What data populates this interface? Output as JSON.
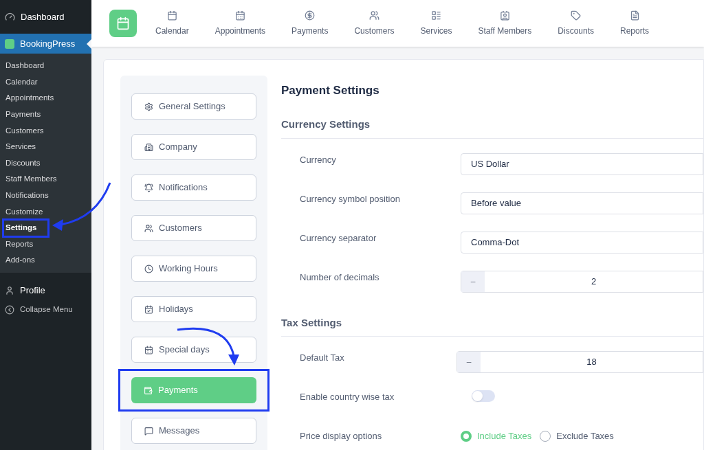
{
  "admin_menu": {
    "top_items": [
      {
        "label": "Dashboard",
        "kind": "dashboard"
      }
    ],
    "plugin": {
      "label": "BookingPress",
      "selected": true
    },
    "submenu": [
      {
        "label": "Dashboard",
        "selected": false
      },
      {
        "label": "Calendar",
        "selected": false
      },
      {
        "label": "Appointments",
        "selected": false
      },
      {
        "label": "Payments",
        "selected": false
      },
      {
        "label": "Customers",
        "selected": false
      },
      {
        "label": "Services",
        "selected": false
      },
      {
        "label": "Discounts",
        "selected": false
      },
      {
        "label": "Staff Members",
        "selected": false
      },
      {
        "label": "Notifications",
        "selected": false
      },
      {
        "label": "Customize",
        "selected": false
      },
      {
        "label": "Settings",
        "selected": true
      },
      {
        "label": "Reports",
        "selected": false
      },
      {
        "label": "Add-ons",
        "selected": false
      }
    ],
    "bottom_items": [
      {
        "label": "Profile",
        "kind": "profile"
      },
      {
        "label": "Collapse Menu",
        "kind": "collapse"
      }
    ]
  },
  "top_nav": [
    {
      "label": "Calendar",
      "kind": "calendar"
    },
    {
      "label": "Appointments",
      "kind": "appointments"
    },
    {
      "label": "Payments",
      "kind": "payments"
    },
    {
      "label": "Customers",
      "kind": "customers"
    },
    {
      "label": "Services",
      "kind": "services"
    },
    {
      "label": "Staff Members",
      "kind": "staff"
    },
    {
      "label": "Discounts",
      "kind": "discounts"
    },
    {
      "label": "Reports",
      "kind": "reports"
    }
  ],
  "settings_menu": [
    {
      "label": "General Settings",
      "kind": "general",
      "selected": false
    },
    {
      "label": "Company",
      "kind": "company",
      "selected": false
    },
    {
      "label": "Notifications",
      "kind": "notifications",
      "selected": false
    },
    {
      "label": "Customers",
      "kind": "customers",
      "selected": false
    },
    {
      "label": "Working Hours",
      "kind": "hours",
      "selected": false
    },
    {
      "label": "Holidays",
      "kind": "holidays",
      "selected": false
    },
    {
      "label": "Special days",
      "kind": "special",
      "selected": false
    },
    {
      "label": "Payments",
      "kind": "payments",
      "selected": true
    },
    {
      "label": "Messages",
      "kind": "messages",
      "selected": false
    }
  ],
  "page_title": "Payment Settings",
  "sections": [
    {
      "title": "Currency Settings",
      "fields": [
        {
          "label": "Currency",
          "kind": "select",
          "value": "US Dollar"
        },
        {
          "label": "Currency symbol position",
          "kind": "select",
          "value": "Before value"
        },
        {
          "label": "Currency separator",
          "kind": "select",
          "value": "Comma-Dot"
        },
        {
          "label": "Number of decimals",
          "kind": "number",
          "value": "2",
          "button": "–"
        }
      ]
    },
    {
      "title": "Tax Settings",
      "fields": [
        {
          "label": "Default Tax",
          "kind": "number",
          "value": "18",
          "button": "–"
        },
        {
          "label": "Enable country wise tax",
          "kind": "toggle",
          "on": false
        },
        {
          "label": "Price display options",
          "kind": "radio",
          "options": [
            {
              "label": "Include Taxes",
              "selected": true
            },
            {
              "label": "Exclude Taxes",
              "selected": false
            }
          ]
        }
      ]
    }
  ]
}
